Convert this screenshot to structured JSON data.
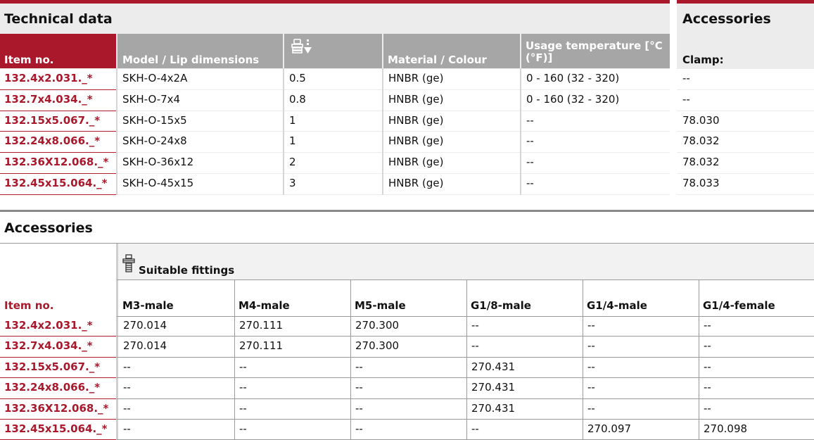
{
  "technical": {
    "title": "Technical data",
    "headers": [
      "Item no.",
      "Model / Lip dimensions",
      "",
      "Material / Colour",
      "Usage temperature [°C (°F)]"
    ],
    "rows": [
      [
        "132.4x2.031._*",
        "SKH-O-4x2A",
        "0.5",
        "HNBR (ge)",
        "0 - 160 (32 - 320)"
      ],
      [
        "132.7x4.034._*",
        "SKH-O-7x4",
        "0.8",
        "HNBR (ge)",
        "0 - 160 (32 - 320)"
      ],
      [
        "132.15x5.067._*",
        "SKH-O-15x5",
        "1",
        "HNBR (ge)",
        "--"
      ],
      [
        "132.24x8.066._*",
        "SKH-O-24x8",
        "1",
        "HNBR (ge)",
        "--"
      ],
      [
        "132.36X12.068._*",
        "SKH-O-36x12",
        "2",
        "HNBR (ge)",
        "--"
      ],
      [
        "132.45x15.064._*",
        "SKH-O-45x15",
        "3",
        "HNBR (ge)",
        "--"
      ]
    ],
    "force_icon": "lifting-force-icon"
  },
  "clamp": {
    "title": "Accessories",
    "header": "Clamp:",
    "values": [
      "--",
      "--",
      "78.030",
      "78.032",
      "78.032",
      "78.033"
    ]
  },
  "accessories": {
    "title": "Accessories",
    "fittings_label": "Suitable fittings",
    "fitting_icon": "fitting-icon",
    "item_header": "Item no.",
    "columns": [
      "M3-male",
      "M4-male",
      "M5-male",
      "G1/8-male",
      "G1/4-male",
      "G1/4-female"
    ],
    "rows": [
      [
        "132.4x2.031._*",
        "270.014",
        "270.111",
        "270.300",
        "--",
        "--",
        "--"
      ],
      [
        "132.7x4.034._*",
        "270.014",
        "270.111",
        "270.300",
        "--",
        "--",
        "--"
      ],
      [
        "132.15x5.067._*",
        "--",
        "--",
        "--",
        "270.431",
        "--",
        "--"
      ],
      [
        "132.24x8.066._*",
        "--",
        "--",
        "--",
        "270.431",
        "--",
        "--"
      ],
      [
        "132.36X12.068._*",
        "--",
        "--",
        "--",
        "270.431",
        "--",
        "--"
      ],
      [
        "132.45x15.064._*",
        "--",
        "--",
        "--",
        "--",
        "270.097",
        "270.098"
      ]
    ]
  },
  "colors": {
    "brand_red": "#a9182b",
    "header_grey": "#a6a6a6",
    "panel_grey": "#ececec"
  }
}
